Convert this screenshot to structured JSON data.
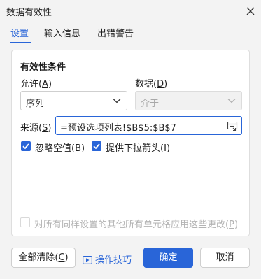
{
  "window": {
    "title": "数据有效性"
  },
  "tabs": [
    {
      "label": "设置",
      "active": true
    },
    {
      "label": "输入信息",
      "active": false
    },
    {
      "label": "出错警告",
      "active": false
    }
  ],
  "criteria": {
    "section_title": "有效性条件",
    "allow_label": "允许",
    "allow_hotkey": "A",
    "allow_value": "序列",
    "data_label": "数据",
    "data_hotkey": "D",
    "data_value": "介于",
    "source_label": "来源",
    "source_hotkey": "S",
    "source_value": "=预设选项列表!$B$5:$B$7",
    "ignore_blank_label": "忽略空值",
    "ignore_blank_hotkey": "B",
    "ignore_blank_checked": true,
    "in_cell_dropdown_label": "提供下拉箭头",
    "in_cell_dropdown_hotkey": "I",
    "in_cell_dropdown_checked": true,
    "apply_all_label": "对所有同样设置的其他所有单元格应用这些更改",
    "apply_all_hotkey": "P",
    "apply_all_checked": false
  },
  "footer": {
    "clear_all_label": "全部清除",
    "clear_all_hotkey": "C",
    "tips_label": "操作技巧",
    "ok_label": "确定",
    "cancel_label": "取消"
  },
  "colors": {
    "accent": "#2965d8",
    "background": "#f3f3f3",
    "panel": "#ffffff"
  }
}
